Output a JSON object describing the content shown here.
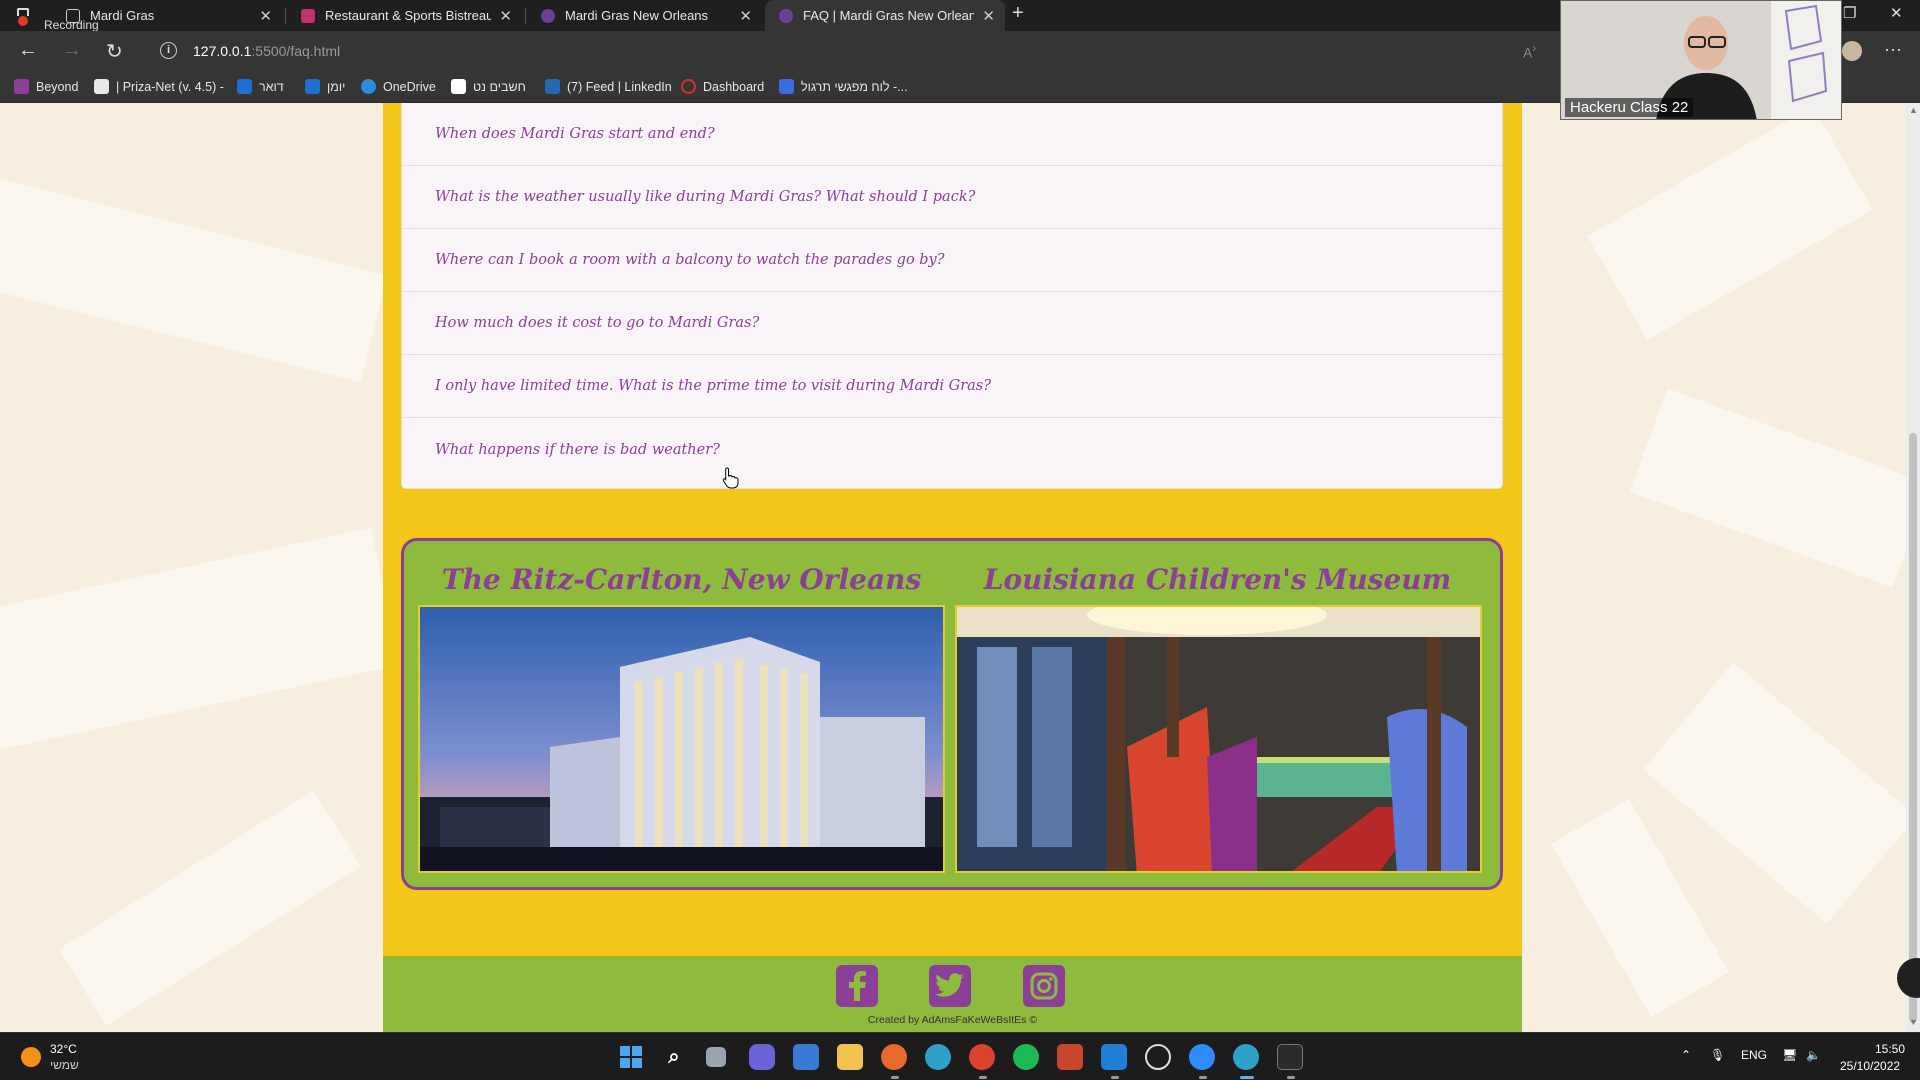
{
  "recording": {
    "label": "Recording"
  },
  "browser": {
    "tabs": [
      {
        "title": "Mardi Gras",
        "active": false
      },
      {
        "title": "Restaurant & Sports Bistreaux | V",
        "active": false
      },
      {
        "title": "Mardi Gras New Orleans",
        "active": false
      },
      {
        "title": "FAQ | Mardi Gras New Orleans",
        "active": true
      }
    ],
    "new_tab_glyph": "+",
    "url_host": "127.0.0.1",
    "url_rest": ":5500/faq.html",
    "bookmarks": [
      {
        "label": "Beyond",
        "icon": "beyond-icon",
        "color": "#8c3f97"
      },
      {
        "label": "| Priza-Net (v. 4.5) -",
        "icon": "priza-net-icon",
        "color": "#e8e8e8"
      },
      {
        "label": "דואר",
        "icon": "outlook-mail-icon",
        "color": "#1e6fd1"
      },
      {
        "label": "יומן",
        "icon": "calendar-icon",
        "color": "#1e6fd1"
      },
      {
        "label": "OneDrive",
        "icon": "onedrive-icon",
        "color": "#2a8de0"
      },
      {
        "label": "חשבים נט",
        "icon": "hashavim-icon",
        "color": "#ffffff"
      },
      {
        "label": "(7) Feed | LinkedIn",
        "icon": "linkedin-icon",
        "color": "#2867b2"
      },
      {
        "label": "Dashboard",
        "icon": "dashboard-icon",
        "color": "#d9322b"
      },
      {
        "label": "לוח מפגשי תרגול -...",
        "icon": "schedule-icon",
        "color": "#3d6be0"
      }
    ]
  },
  "webcam": {
    "name": "Hackeru Class 22"
  },
  "faq": {
    "questions": [
      "When does Mardi Gras start and end?",
      "What is the weather usually like during Mardi Gras? What should I pack?",
      "Where can I book a room with a balcony to watch the parades go by?",
      "How much does it cost to go to Mardi Gras?",
      "I only have limited time. What is the prime time to visit during Mardi Gras?",
      "What happens if there is bad weather?"
    ]
  },
  "attractions": [
    {
      "title": "The Ritz-Carlton, New Orleans",
      "image": "ritz-carlton-hotel-photo"
    },
    {
      "title": "Louisiana Children's Museum",
      "image": "childrens-museum-photo"
    }
  ],
  "footer": {
    "social": [
      {
        "name": "facebook-icon",
        "glyph": "f"
      },
      {
        "name": "twitter-icon",
        "glyph": "t"
      },
      {
        "name": "instagram-icon",
        "glyph": "i"
      }
    ],
    "copyright": "Created by AdAmsFaKeWeBsItEs ©"
  },
  "taskbar": {
    "weather": {
      "temp": "32°C",
      "desc": "שמשי"
    },
    "language": "ENG",
    "time": "15:50",
    "date": "25/10/2022"
  },
  "colors": {
    "purple": "#8c3f97",
    "yellow": "#f2c718",
    "green": "#8fbb3d",
    "page_bg": "#f8eee0"
  }
}
